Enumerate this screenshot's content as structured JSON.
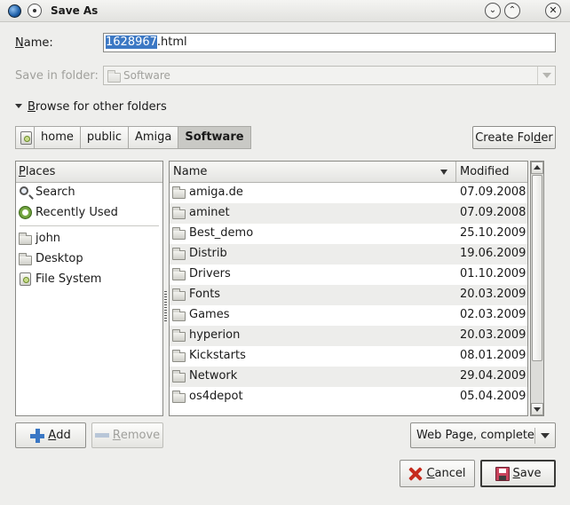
{
  "window": {
    "title": "Save As"
  },
  "name_field": {
    "label_prefix": "N",
    "label_rest": "ame:",
    "filename_selected": "1628967",
    "filename_ext": ".html"
  },
  "save_in_folder": {
    "label": "Save in folder:",
    "value": "Software"
  },
  "browse": {
    "label_prefix": "B",
    "label_rest": "rowse for other folders"
  },
  "path_bar": {
    "segments": [
      "home",
      "public",
      "Amiga",
      "Software"
    ],
    "active_index": 3
  },
  "create_folder_button": {
    "label_pre": "Create Fol",
    "label_u": "d",
    "label_post": "er"
  },
  "places": {
    "header_u": "P",
    "header_rest": "laces",
    "items": [
      {
        "label": "Search",
        "icon": "search-icon"
      },
      {
        "label": "Recently Used",
        "icon": "recently-used-icon"
      },
      {
        "label": "john",
        "icon": "folder-icon"
      },
      {
        "label": "Desktop",
        "icon": "folder-icon"
      },
      {
        "label": "File System",
        "icon": "drive-icon"
      }
    ]
  },
  "file_list": {
    "columns": {
      "name": "Name",
      "modified": "Modified"
    },
    "rows": [
      {
        "name": "amiga.de",
        "modified": "07.09.2008"
      },
      {
        "name": "aminet",
        "modified": "07.09.2008"
      },
      {
        "name": "Best_demo",
        "modified": "25.10.2009"
      },
      {
        "name": "Distrib",
        "modified": "19.06.2009"
      },
      {
        "name": "Drivers",
        "modified": "01.10.2009"
      },
      {
        "name": "Fonts",
        "modified": "20.03.2009"
      },
      {
        "name": "Games",
        "modified": "02.03.2009"
      },
      {
        "name": "hyperion",
        "modified": "20.03.2009"
      },
      {
        "name": "Kickstarts",
        "modified": "08.01.2009"
      },
      {
        "name": "Network",
        "modified": "29.04.2009"
      },
      {
        "name": "os4depot",
        "modified": "05.04.2009"
      }
    ]
  },
  "add_button": {
    "label_u": "A",
    "label_rest": "dd"
  },
  "remove_button": {
    "label_u": "R",
    "label_rest": "emove"
  },
  "file_type": {
    "value": "Web Page, complete"
  },
  "cancel_button": {
    "label_u": "C",
    "label_rest": "ancel"
  },
  "save_button": {
    "label_u": "S",
    "label_rest": "ave"
  }
}
